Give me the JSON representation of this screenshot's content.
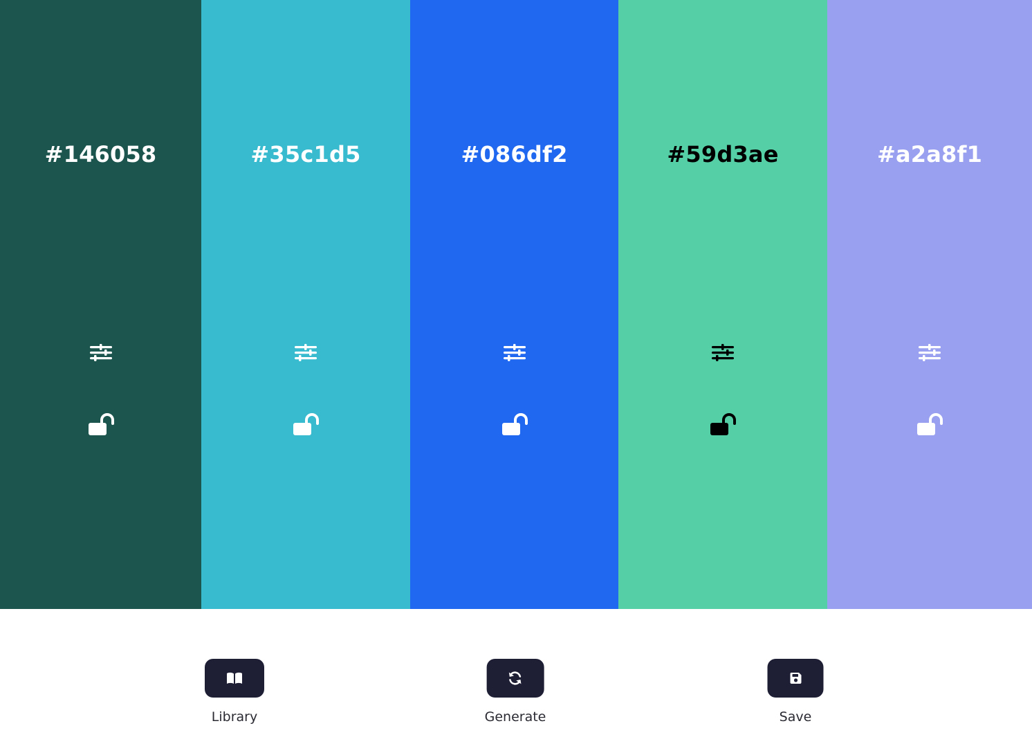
{
  "palette": {
    "swatches": [
      {
        "hex": "#146058",
        "background": "#1b554e",
        "text_color": "#ffffff",
        "locked": false
      },
      {
        "hex": "#35c1d5",
        "background": "#38bacf",
        "text_color": "#ffffff",
        "locked": false
      },
      {
        "hex": "#086df2",
        "background": "#2068ef",
        "text_color": "#ffffff",
        "locked": false
      },
      {
        "hex": "#59d3ae",
        "background": "#55cfa6",
        "text_color": "#000000",
        "locked": false
      },
      {
        "hex": "#a2a8f1",
        "background": "#99a0ef",
        "text_color": "#ffffff",
        "locked": false
      }
    ]
  },
  "actions": {
    "library": {
      "label": "Library",
      "icon": "book-icon"
    },
    "generate": {
      "label": "Generate",
      "icon": "refresh-icon"
    },
    "save": {
      "label": "Save",
      "icon": "save-icon"
    }
  },
  "colors": {
    "button_background": "#1e1e35",
    "label_text": "#2a2a33"
  }
}
